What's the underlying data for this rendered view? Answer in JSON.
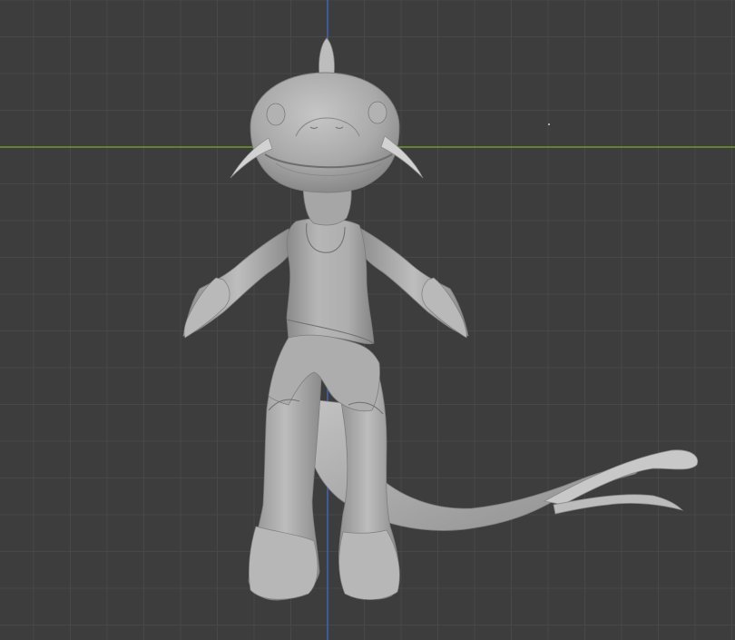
{
  "viewport": {
    "view": "front-orthographic",
    "background_color": "#3d3d3d",
    "grid_minor_color": "#484848",
    "grid_major_color": "#555555",
    "x_axis_color": "#6f9a2a",
    "z_axis_color": "#4263b5",
    "mesh_color": "#b4b4b4"
  },
  "model": {
    "name": "catfish-humanoid-sculpt",
    "parts": [
      "head",
      "barbels",
      "dorsal-fin",
      "eyes",
      "neck",
      "torso-tank-top",
      "arms",
      "hands",
      "legs",
      "feet",
      "tail",
      "tail-fin"
    ]
  }
}
